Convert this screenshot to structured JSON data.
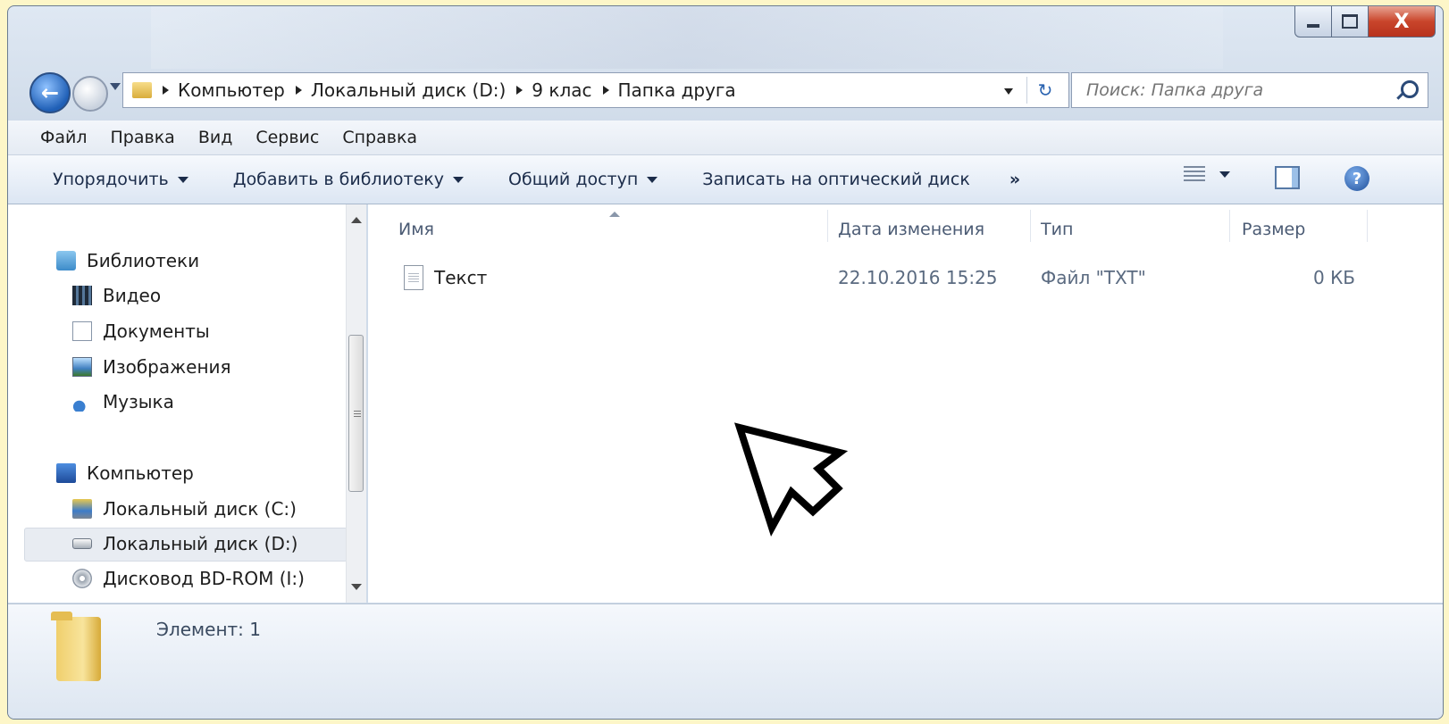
{
  "window": {
    "caption": {
      "minimize_glyph": "–",
      "maximize_glyph": "□",
      "close_glyph": "X"
    }
  },
  "navigation": {
    "breadcrumbs": [
      "Компьютер",
      "Локальный диск (D:)",
      "9 клас",
      "Папка друга"
    ],
    "search_placeholder": "Поиск: Папка друга"
  },
  "menu": {
    "items": [
      "Файл",
      "Правка",
      "Вид",
      "Сервис",
      "Справка"
    ]
  },
  "toolbar": {
    "organize": "Упорядочить",
    "add_to_library": "Добавить в библиотеку",
    "share": "Общий доступ",
    "burn": "Записать на оптический диск",
    "more": "»",
    "help": "?"
  },
  "nav_pane": {
    "libraries": "Библиотеки",
    "library_items": [
      "Видео",
      "Документы",
      "Изображения",
      "Музыка"
    ],
    "computer": "Компьютер",
    "drives": [
      "Локальный диск (C:)",
      "Локальный диск (D:)",
      "Дисковод BD-ROM (I:)"
    ],
    "selected": "Локальный диск (D:)"
  },
  "file_list": {
    "columns": [
      "Имя",
      "Дата изменения",
      "Тип",
      "Размер"
    ],
    "rows": [
      {
        "name": "Текст",
        "modified": "22.10.2016 15:25",
        "type": "Файл \"TXT\"",
        "size": "0 КБ"
      }
    ]
  },
  "details": {
    "status": "Элемент: 1"
  },
  "colors": {
    "background_frame": "#fdf6c8",
    "window_chrome": "#cfdbe9",
    "close_button": "#c9452b",
    "accent_blue": "#1f5fb6"
  }
}
